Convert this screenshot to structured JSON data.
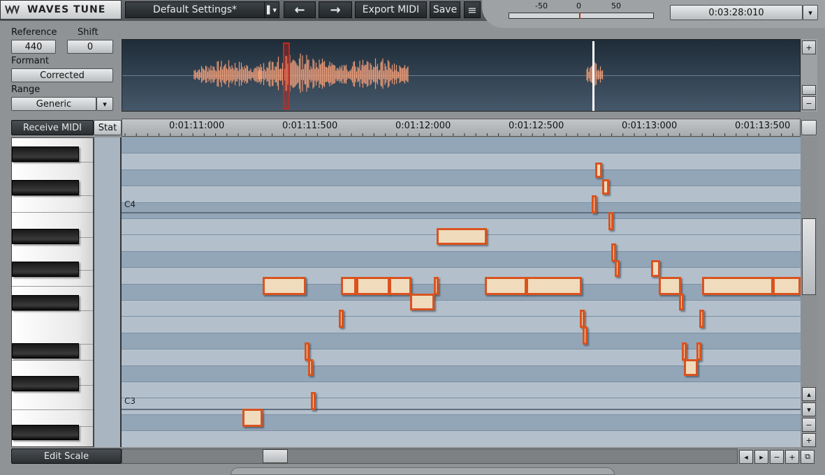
{
  "app": {
    "title": "WAVES TUNE",
    "logo_mark": "W"
  },
  "toolbar": {
    "preset": "Default Settings*",
    "preset_arrow": "▌▾",
    "back": "←",
    "forward": "→",
    "export_midi": "Export MIDI",
    "save": "Save",
    "menu": "≡"
  },
  "meter": {
    "labels": [
      "-50",
      "0",
      "50"
    ]
  },
  "time_display": {
    "value": "0:03:28:010",
    "arrow": "▾"
  },
  "left_panel": {
    "reference_label": "Reference",
    "reference_value": "440",
    "shift_label": "Shift",
    "shift_value": "0",
    "formant_label": "Formant",
    "formant_value": "Corrected",
    "range_label": "Range",
    "range_value": "Generic",
    "range_arrow": "▾"
  },
  "overview_controls": {
    "plus": "+",
    "minus": "−"
  },
  "grid_header": {
    "receive_midi": "Receive MIDI",
    "stat": "Stat"
  },
  "timeline": {
    "labels": [
      "0:01:11:000",
      "0:01:11:500",
      "0:01:12:000",
      "0:01:12:500",
      "0:01:13:000",
      "0:01:13:500"
    ]
  },
  "note_labels": {
    "c4": "C4",
    "c3": "C3"
  },
  "bottom": {
    "edit_scale": "Edit Scale",
    "nav_left": "◂",
    "nav_right": "▸",
    "zoom_out": "−",
    "zoom_in": "+",
    "fit": "⧉"
  },
  "vscroll": {
    "up": "▴",
    "down": "▾",
    "minus": "−",
    "plus": "+"
  },
  "colors": {
    "note_fill": "#f0dcbd",
    "note_border": "#d9531f",
    "waveform": "#e89a77",
    "playhead": "#ffffff"
  }
}
